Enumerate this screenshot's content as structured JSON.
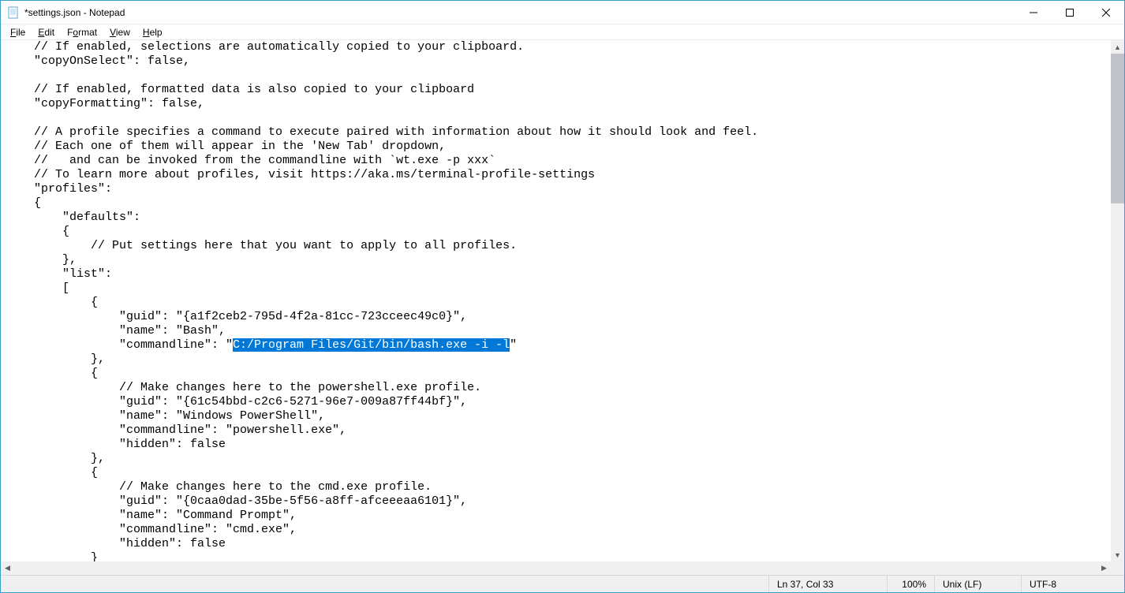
{
  "window": {
    "title": "*settings.json - Notepad"
  },
  "menu": {
    "file": "File",
    "edit": "Edit",
    "format": "Format",
    "view": "View",
    "help": "Help"
  },
  "editor": {
    "lines_before": "    // If enabled, selections are automatically copied to your clipboard.\n    \"copyOnSelect\": false,\n\n    // If enabled, formatted data is also copied to your clipboard\n    \"copyFormatting\": false,\n\n    // A profile specifies a command to execute paired with information about how it should look and feel.\n    // Each one of them will appear in the 'New Tab' dropdown,\n    //   and can be invoked from the commandline with `wt.exe -p xxx`\n    // To learn more about profiles, visit https://aka.ms/terminal-profile-settings\n    \"profiles\":\n    {\n        \"defaults\":\n        {\n            // Put settings here that you want to apply to all profiles.\n        },\n        \"list\":\n        [\n            {\n                \"guid\": \"{a1f2ceb2-795d-4f2a-81cc-723cceec49c0}\",\n                \"name\": \"Bash\",\n                \"commandline\": \"",
    "selected": "C:/Program Files/Git/bin/bash.exe -i -l",
    "lines_after": "\"\n            },\n            {\n                // Make changes here to the powershell.exe profile.\n                \"guid\": \"{61c54bbd-c2c6-5271-96e7-009a87ff44bf}\",\n                \"name\": \"Windows PowerShell\",\n                \"commandline\": \"powershell.exe\",\n                \"hidden\": false\n            },\n            {\n                // Make changes here to the cmd.exe profile.\n                \"guid\": \"{0caa0dad-35be-5f56-a8ff-afceeeaa6101}\",\n                \"name\": \"Command Prompt\",\n                \"commandline\": \"cmd.exe\",\n                \"hidden\": false\n            }"
  },
  "status": {
    "position": "Ln 37, Col 33",
    "zoom": "100%",
    "line_ending": "Unix (LF)",
    "encoding": "UTF-8"
  }
}
